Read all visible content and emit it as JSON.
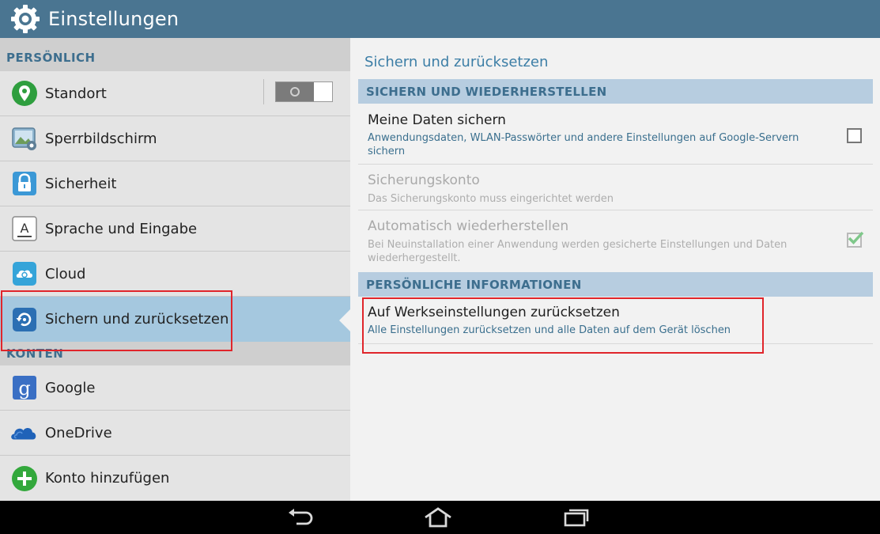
{
  "app": {
    "title": "Einstellungen",
    "icon": "gear-icon",
    "accent_color": "#4a7591"
  },
  "sidebar": {
    "sections": [
      {
        "header": "PERSÖNLICH",
        "items": [
          {
            "label": "Standort",
            "icon": "location-pin-icon",
            "toggle": "off"
          },
          {
            "label": "Sperrbildschirm",
            "icon": "lockscreen-image-icon"
          },
          {
            "label": "Sicherheit",
            "icon": "padlock-icon"
          },
          {
            "label": "Sprache und Eingabe",
            "icon": "keyboard-letter-icon"
          },
          {
            "label": "Cloud",
            "icon": "cloud-icon"
          },
          {
            "label": "Sichern und zurücksetzen",
            "icon": "backup-restore-icon",
            "selected": true
          }
        ]
      },
      {
        "header": "KONTEN",
        "items": [
          {
            "label": "Google",
            "icon": "google-icon"
          },
          {
            "label": "OneDrive",
            "icon": "onedrive-icon"
          },
          {
            "label": "Konto hinzufügen",
            "icon": "add-account-icon"
          }
        ]
      }
    ],
    "selected_color": "#a5c8df"
  },
  "main": {
    "title": "Sichern und zurücksetzen",
    "sections": [
      {
        "header": "SICHERN UND WIEDERHERSTELLEN",
        "prefs": [
          {
            "title": "Meine Daten sichern",
            "summary": "Anwendungsdaten, WLAN-Passwörter und andere Einstellungen auf Google-Servern sichern",
            "checkbox": false,
            "enabled": true
          },
          {
            "title": "Sicherungskonto",
            "summary": "Das Sicherungskonto muss eingerichtet werden",
            "enabled": false
          },
          {
            "title": "Automatisch wiederherstellen",
            "summary": "Bei Neuinstallation einer Anwendung werden gesicherte Einstellungen und Daten wiederhergestellt.",
            "checkbox": true,
            "enabled": false
          }
        ]
      },
      {
        "header": "PERSÖNLICHE INFORMATIONEN",
        "prefs": [
          {
            "title": "Auf Werkseinstellungen zurücksetzen",
            "summary": "Alle Einstellungen zurücksetzen und alle Daten auf dem Gerät löschen",
            "enabled": true
          }
        ]
      }
    ]
  },
  "navbar": {
    "buttons": [
      "back-icon",
      "home-icon",
      "recent-apps-icon"
    ]
  },
  "highlight_color": "#e0252b"
}
